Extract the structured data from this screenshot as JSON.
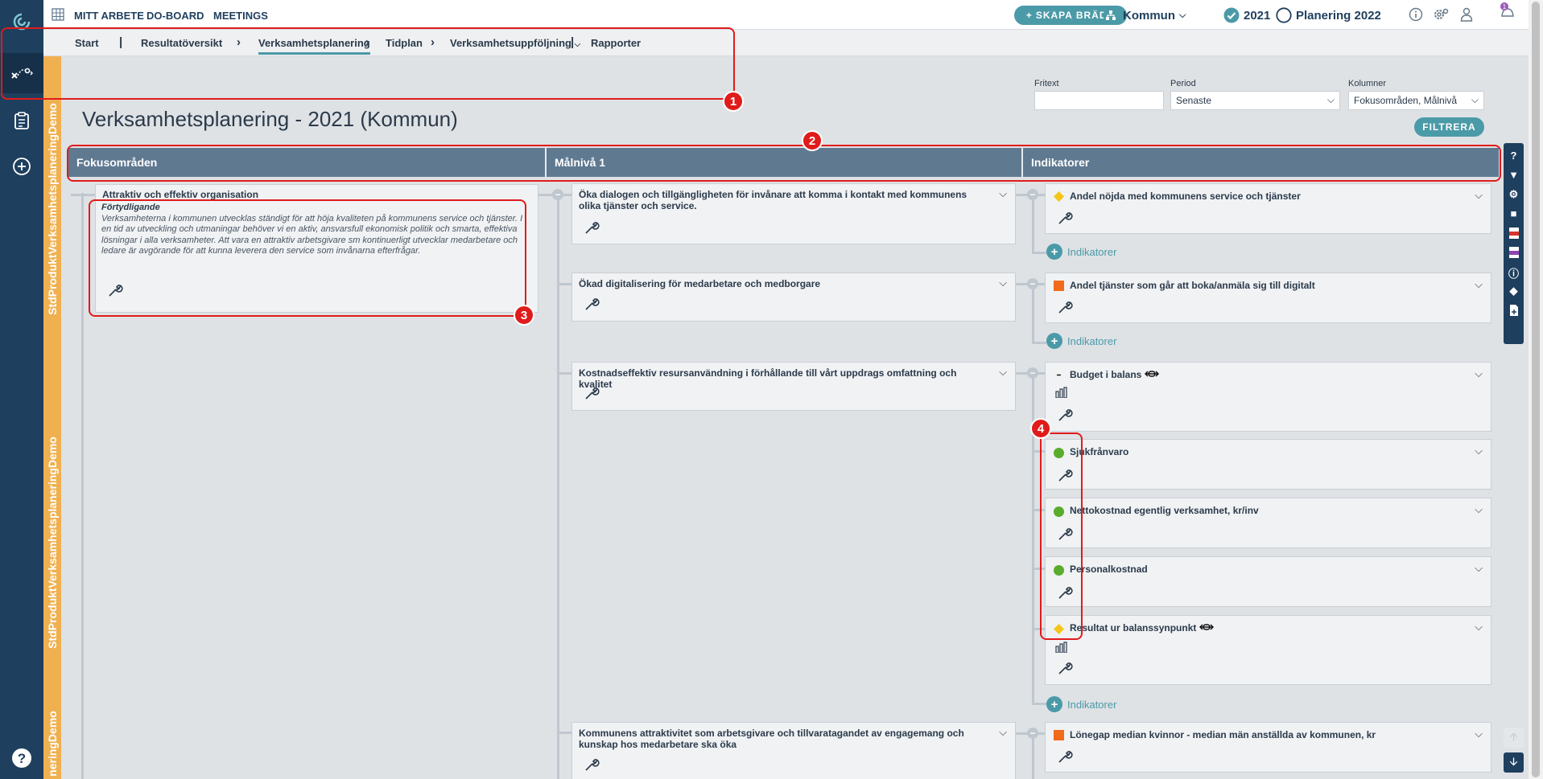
{
  "topbar": {
    "links": [
      "MITT ARBETE",
      "DO-BOARD",
      "MEETINGS"
    ],
    "create_button": "SKAPA BRÄDA",
    "org": "Kommun",
    "year": "2021",
    "plan": "Planering 2022"
  },
  "breadcrumbs": [
    "Start",
    "Resultatöversikt",
    "Verksamhetsplanering",
    "Tidplan",
    "Verksamhetsuppföljning",
    "Rapporter"
  ],
  "strip_labels": [
    "StdProduktVerksamhetsplaneringDemo",
    "StdProduktVerksamhetsplaneringDemo",
    "neringDemo"
  ],
  "page_title": "Verksamhetsplanering - 2021 (Kommun)",
  "filters": {
    "fritext_label": "Fritext",
    "fritext_value": "",
    "period_label": "Period",
    "period_value": "Senaste",
    "kolumner_label": "Kolumner",
    "kolumner_value": "Fokusområden, Målnivå",
    "filter_button": "FILTRERA"
  },
  "columns": [
    "Fokusområden",
    "Målnivå 1",
    "Indikatorer"
  ],
  "focus_area": {
    "title": "Attraktiv och effektiv organisation",
    "note_label": "Förtydligande",
    "note_text": "Verksamheterna i kommunen utvecklas ständigt för att höja kvaliteten på kommunens service och tjänster. I en tid av utveckling och utmaningar behöver vi en aktiv, ansvarsfull ekonomisk politik och smarta, effektiva lösningar i alla verksamheter. Att vara en attraktiv arbetsgivare sm kontinuerligt utvecklar medarbetare och ledare är avgörande för att kunna leverera den service som invånarna efterfrågar."
  },
  "goals": [
    "Öka dialogen och tillgängligheten för invånare att komma i kontakt med kommunens olika tjänster och service.",
    "Ökad digitalisering för medarbetare och medborgare",
    "Kostnadseffektiv resursanvändning i förhållande till vårt uppdrags omfattning och kvalitet",
    "Kommunens attraktivitet som arbetsgivare och tillvaratagandet av engagemang och kunskap hos medarbetare ska öka"
  ],
  "indicators": [
    {
      "name": "Andel nöjda med kommunens service och tjänster",
      "status": "yellow"
    },
    {
      "name": "Andel tjänster som går att boka/anmäla sig till digitalt",
      "status": "orange"
    },
    {
      "name": "Budget i balans",
      "status": "black"
    },
    {
      "name": "Sjukfrånvaro",
      "status": "green"
    },
    {
      "name": "Nettokostnad egentlig verksamhet, kr/inv",
      "status": "green"
    },
    {
      "name": "Personalkostnad",
      "status": "green"
    },
    {
      "name": "Resultat ur balanssynpunkt",
      "status": "yellow"
    },
    {
      "name": "Lönegap median kvinnor - median män anställda av kommunen, kr",
      "status": "orange"
    }
  ],
  "add_indicator_label": "Indikatorer",
  "annotations": [
    "1",
    "2",
    "3",
    "4"
  ],
  "colors": {
    "nav": "#1f3f5e",
    "accent": "#4b9aa8",
    "strip": "#f0b050",
    "header": "#5f7991",
    "annotation": "#e01b1b",
    "green": "#5aac2c",
    "yellow": "#f5c518",
    "orange": "#f26a1b"
  }
}
